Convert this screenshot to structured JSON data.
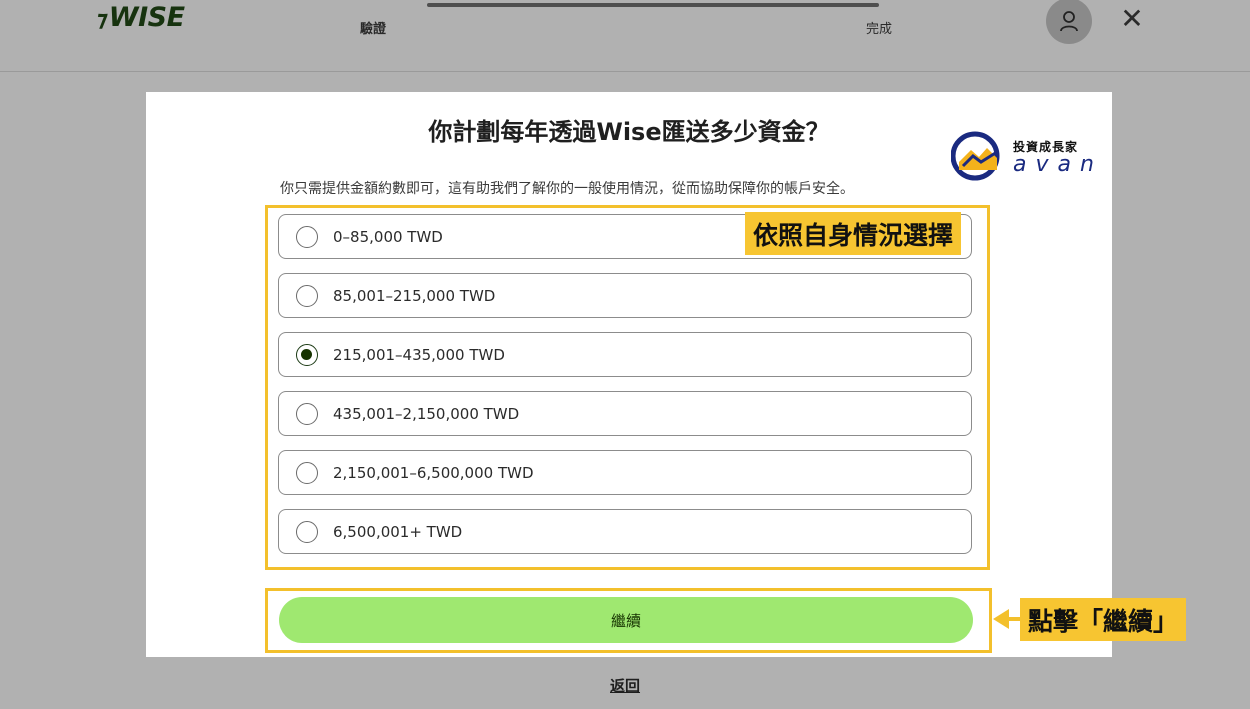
{
  "header": {
    "logo": "WISE",
    "steps": [
      {
        "label": "驗證"
      },
      {
        "label": "完成"
      }
    ]
  },
  "modal": {
    "title": "你計劃每年透過Wise匯送多少資金？",
    "subtitle": "你只需提供金額約數即可，這有助我們了解你的一般使用情況，從而協助保障你的帳戶安全。",
    "options": [
      {
        "label": "0–85,000 TWD",
        "checked": false
      },
      {
        "label": "85,001–215,000 TWD",
        "checked": false
      },
      {
        "label": "215,001–435,000 TWD",
        "checked": true
      },
      {
        "label": "435,001–2,150,000 TWD",
        "checked": false
      },
      {
        "label": "2,150,001–6,500,000 TWD",
        "checked": false
      },
      {
        "label": "6,500,001+ TWD",
        "checked": false
      }
    ],
    "continue_label": "繼續"
  },
  "footer": {
    "back_label": "返回"
  },
  "brand_overlay": {
    "top_text": "投資成長家",
    "bottom_text": "avan"
  },
  "annotations": {
    "options_callout": "依照自身情況選擇",
    "continue_callout": "點擊「繼續」"
  },
  "colors": {
    "accent": "#9fe870",
    "highlight": "#f7c531",
    "logo": "#17330f"
  }
}
